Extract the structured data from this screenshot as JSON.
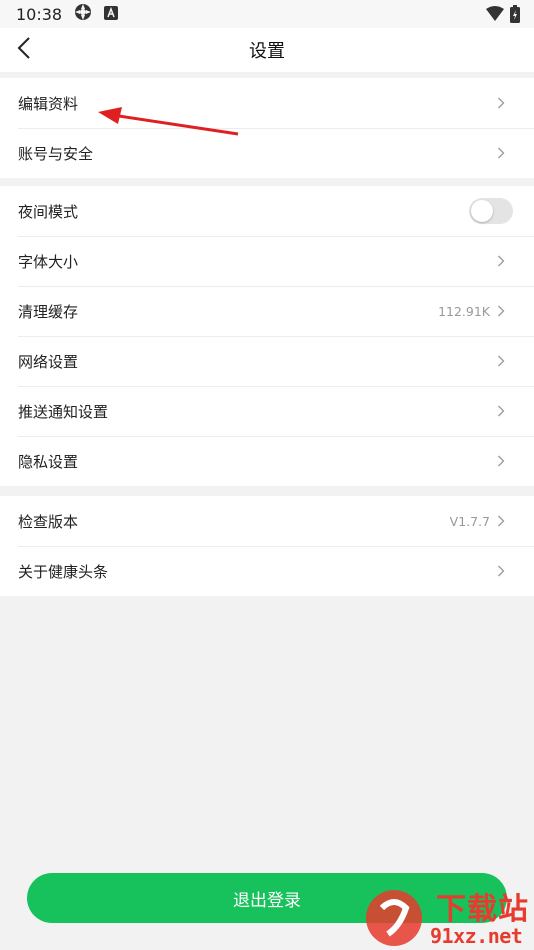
{
  "status_bar": {
    "time": "10:38"
  },
  "header": {
    "title": "设置"
  },
  "groups": [
    {
      "items": [
        {
          "label": "编辑资料"
        },
        {
          "label": "账号与安全"
        }
      ]
    },
    {
      "items": [
        {
          "label": "夜间模式",
          "toggle_on": false
        },
        {
          "label": "字体大小"
        },
        {
          "label": "清理缓存",
          "value": "112.91K"
        },
        {
          "label": "网络设置"
        },
        {
          "label": "推送通知设置"
        },
        {
          "label": "隐私设置"
        }
      ]
    },
    {
      "items": [
        {
          "label": "检查版本",
          "value": "V1.7.7"
        },
        {
          "label": "关于健康头条"
        }
      ]
    }
  ],
  "logout_label": "退出登录",
  "watermark": {
    "cn_text": "下载站",
    "site_text": "91xz.net"
  },
  "colors": {
    "accent": "#17c15b",
    "annotation_arrow": "#e02020"
  },
  "icons": [
    "back-arrow-icon",
    "chevron-right-icon",
    "wifi-icon",
    "battery-icon"
  ]
}
